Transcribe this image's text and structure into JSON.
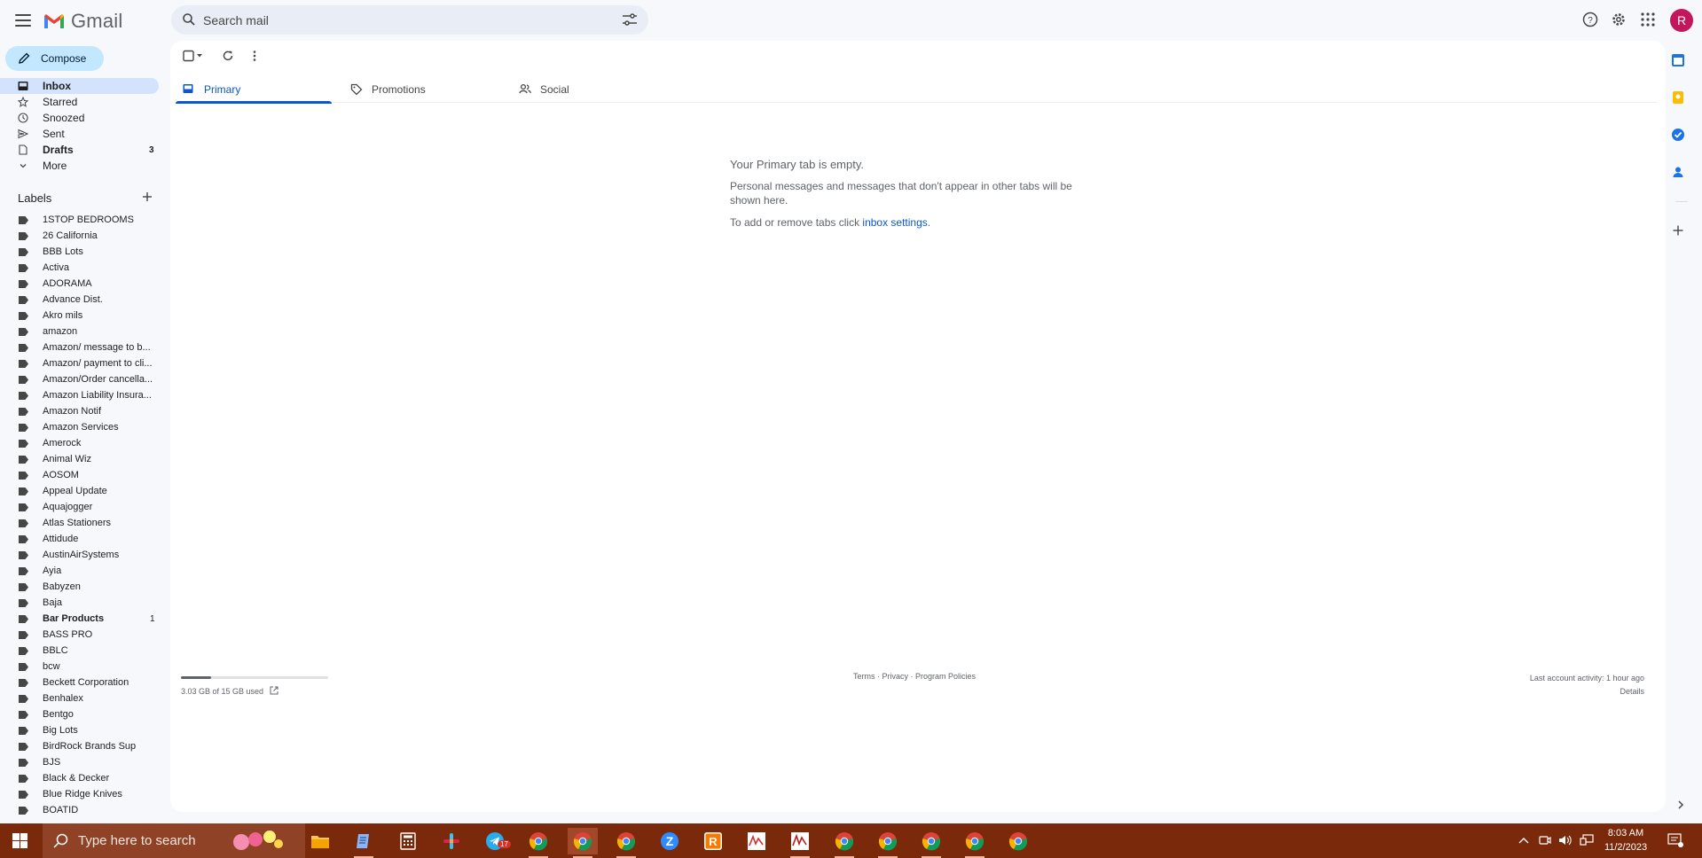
{
  "app": {
    "name": "Gmail",
    "avatar_letter": "R"
  },
  "search": {
    "placeholder": "Search mail"
  },
  "compose_label": "Compose",
  "nav": [
    {
      "label": "Inbox",
      "icon": "inbox-icon",
      "active": true,
      "count": ""
    },
    {
      "label": "Starred",
      "icon": "star-icon",
      "active": false,
      "count": ""
    },
    {
      "label": "Snoozed",
      "icon": "clock-icon",
      "active": false,
      "count": ""
    },
    {
      "label": "Sent",
      "icon": "send-icon",
      "active": false,
      "count": ""
    },
    {
      "label": "Drafts",
      "icon": "draft-icon",
      "active": false,
      "count": "3"
    },
    {
      "label": "More",
      "icon": "chevron-down-icon",
      "active": false,
      "count": ""
    }
  ],
  "labels_heading": "Labels",
  "labels": [
    {
      "name": "1STOP BEDROOMS",
      "count": ""
    },
    {
      "name": "26 California",
      "count": ""
    },
    {
      "name": "BBB Lots",
      "count": ""
    },
    {
      "name": "Activa",
      "count": ""
    },
    {
      "name": "ADORAMA",
      "count": ""
    },
    {
      "name": "Advance Dist.",
      "count": ""
    },
    {
      "name": "Akro mils",
      "count": ""
    },
    {
      "name": "amazon",
      "count": ""
    },
    {
      "name": "Amazon/ message to b...",
      "count": ""
    },
    {
      "name": "Amazon/ payment to cli...",
      "count": ""
    },
    {
      "name": "Amazon/Order cancella...",
      "count": ""
    },
    {
      "name": "Amazon Liability Insura...",
      "count": ""
    },
    {
      "name": "Amazon Notif",
      "count": ""
    },
    {
      "name": "Amazon Services",
      "count": ""
    },
    {
      "name": "Amerock",
      "count": ""
    },
    {
      "name": "Animal Wiz",
      "count": ""
    },
    {
      "name": "AOSOM",
      "count": ""
    },
    {
      "name": "Appeal Update",
      "count": ""
    },
    {
      "name": "Aquajogger",
      "count": ""
    },
    {
      "name": "Atlas Stationers",
      "count": ""
    },
    {
      "name": "Attidude",
      "count": ""
    },
    {
      "name": "AustinAirSystems",
      "count": ""
    },
    {
      "name": "Ayia",
      "count": ""
    },
    {
      "name": "Babyzen",
      "count": ""
    },
    {
      "name": "Baja",
      "count": ""
    },
    {
      "name": "Bar Products",
      "count": "1",
      "bold": true
    },
    {
      "name": "BASS PRO",
      "count": ""
    },
    {
      "name": "BBLC",
      "count": ""
    },
    {
      "name": "bcw",
      "count": ""
    },
    {
      "name": "Beckett Corporation",
      "count": ""
    },
    {
      "name": "Benhalex",
      "count": ""
    },
    {
      "name": "Bentgo",
      "count": ""
    },
    {
      "name": "Big Lots",
      "count": ""
    },
    {
      "name": "BirdRock Brands Sup",
      "count": ""
    },
    {
      "name": "BJS",
      "count": ""
    },
    {
      "name": "Black & Decker",
      "count": ""
    },
    {
      "name": "Blue Ridge Knives",
      "count": ""
    },
    {
      "name": "BOATID",
      "count": ""
    }
  ],
  "tabs": [
    {
      "label": "Primary",
      "icon": "inbox-tab-icon",
      "active": true
    },
    {
      "label": "Promotions",
      "icon": "tag-icon",
      "active": false
    },
    {
      "label": "Social",
      "icon": "people-icon",
      "active": false
    }
  ],
  "empty_state": {
    "title": "Your Primary tab is empty.",
    "body": "Personal messages and messages that don't appear in other tabs will be shown here.",
    "hint_prefix": "To add or remove tabs click ",
    "hint_link": "inbox settings",
    "hint_suffix": "."
  },
  "storage": {
    "text": "3.03 GB of 15 GB used",
    "used_fraction": 0.202
  },
  "footer": {
    "links": "Terms · Privacy · Program Policies"
  },
  "activity": {
    "last": "Last account activity: 1 hour ago",
    "details": "Details"
  },
  "taskbar": {
    "search_placeholder": "Type here to search",
    "time": "8:03 AM",
    "date": "11/2/2023",
    "telegram_badge": "17"
  },
  "colors": {
    "accent": "#0b57d0",
    "compose_bg": "#c2e7ff",
    "active_nav": "#d3e3fd",
    "avatar": "#c2185b",
    "taskbar": "#7a2a0a"
  }
}
